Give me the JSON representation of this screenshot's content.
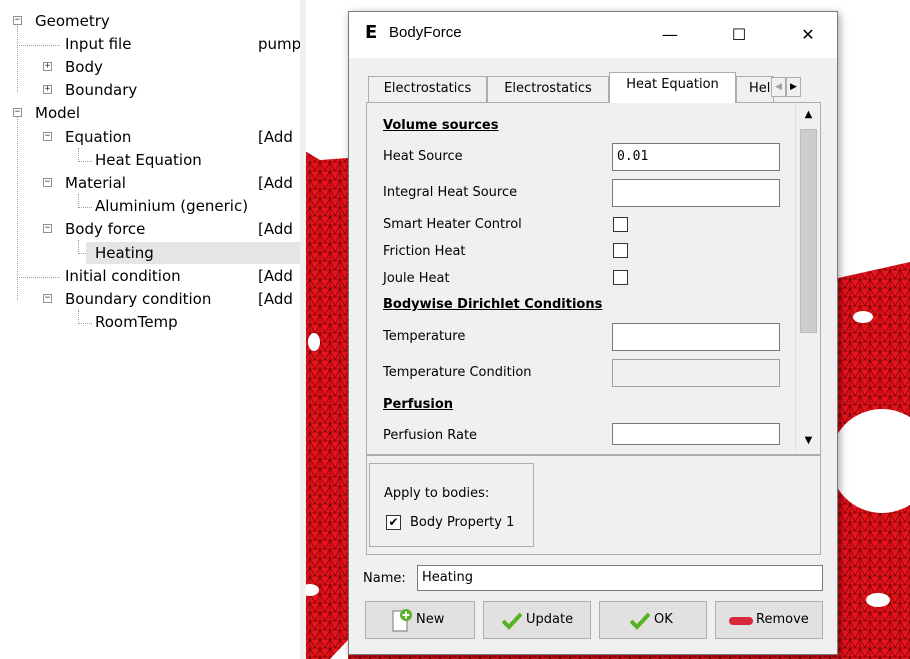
{
  "tree": {
    "items": [
      {
        "label": "Geometry",
        "value": ""
      },
      {
        "label": "Input file",
        "value": "pump"
      },
      {
        "label": "Body",
        "value": ""
      },
      {
        "label": "Boundary",
        "value": ""
      },
      {
        "label": "Model",
        "value": ""
      },
      {
        "label": "Equation",
        "value": "[Add"
      },
      {
        "label": "Heat Equation",
        "value": ""
      },
      {
        "label": "Material",
        "value": "[Add"
      },
      {
        "label": "Aluminium (generic)",
        "value": ""
      },
      {
        "label": "Body force",
        "value": "[Add"
      },
      {
        "label": "Heating",
        "value": ""
      },
      {
        "label": "Initial condition",
        "value": "[Add"
      },
      {
        "label": "Boundary condition",
        "value": "[Add"
      },
      {
        "label": "RoomTemp",
        "value": ""
      }
    ],
    "expander_minus": "−",
    "expander_plus": "+"
  },
  "dialog": {
    "app_icon": "E",
    "title": "BodyForce",
    "minimize": "—",
    "maximize": "☐",
    "close": "✕",
    "tabs": [
      "Electrostatics",
      "Electrostatics",
      "Heat Equation",
      "Heli"
    ],
    "active_tab": "Heat Equation",
    "tab_left": "◀",
    "tab_right": "▶",
    "sections": {
      "volume_sources": "Volume sources",
      "bodywise": "Bodywise Dirichlet Conditions",
      "perfusion": "Perfusion"
    },
    "fields": {
      "heat_source_label": "Heat Source",
      "heat_source_value": "0.01",
      "integral_heat_source_label": "Integral Heat Source",
      "integral_heat_source_value": "",
      "smart_heater_label": "Smart Heater Control",
      "friction_heat_label": "Friction Heat",
      "joule_heat_label": "Joule Heat",
      "temperature_label": "Temperature",
      "temperature_value": "",
      "temperature_condition_label": "Temperature Condition",
      "perfusion_rate_label": "Perfusion Rate",
      "perfusion_rate_value": ""
    },
    "scroll_up": "▲",
    "scroll_down": "▼",
    "apply": {
      "label": "Apply to bodies:",
      "body_label": "Body Property 1",
      "checked_mark": "✔"
    },
    "name": {
      "label": "Name:",
      "value": "Heating"
    },
    "buttons": {
      "new": "New",
      "update": "Update",
      "ok": "OK",
      "remove": "Remove"
    }
  },
  "colors": {
    "mesh_red": "#e8131b",
    "mesh_lines": "#6a0000",
    "check_green": "#57b227",
    "remove_red": "#d9263a"
  }
}
